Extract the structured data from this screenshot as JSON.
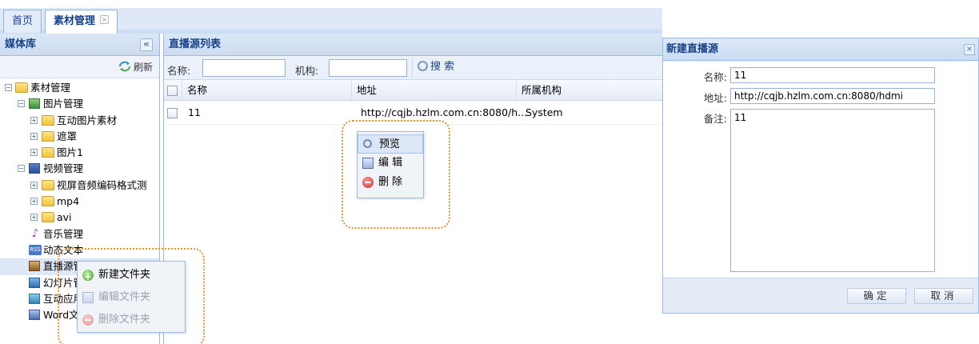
{
  "tabs": [
    {
      "label": "首页",
      "active": false
    },
    {
      "label": "素材管理",
      "active": true,
      "close": "×"
    }
  ],
  "left_panel": {
    "title": "媒体库",
    "collapse_glyph": "«",
    "refresh_label": "刷新",
    "tree": [
      {
        "label": "素材管理",
        "level": 0,
        "expander": "−",
        "icon": "folder-icon"
      },
      {
        "label": "图片管理",
        "level": 1,
        "expander": "−",
        "icon": "image-icon"
      },
      {
        "label": "互动图片素材",
        "level": 2,
        "expander": "+",
        "icon": "folder-icon"
      },
      {
        "label": "遮罩",
        "level": 2,
        "expander": "+",
        "icon": "folder-icon"
      },
      {
        "label": "图片1",
        "level": 2,
        "expander": "+",
        "icon": "folder-icon"
      },
      {
        "label": "视频管理",
        "level": 1,
        "expander": "−",
        "icon": "video-icon"
      },
      {
        "label": "视屏音频编码格式测",
        "level": 2,
        "expander": "+",
        "icon": "folder-icon"
      },
      {
        "label": "mp4",
        "level": 2,
        "expander": "+",
        "icon": "folder-icon"
      },
      {
        "label": "avi",
        "level": 2,
        "expander": "+",
        "icon": "folder-icon"
      },
      {
        "label": "音乐管理",
        "level": 1,
        "expander": "",
        "icon": "music-icon"
      },
      {
        "label": "动态文本",
        "level": 1,
        "expander": "",
        "icon": "rss-icon"
      },
      {
        "label": "直播源管理",
        "level": 1,
        "expander": "",
        "icon": "live-icon"
      },
      {
        "label": "幻灯片管理",
        "level": 1,
        "expander": "",
        "icon": "slide-icon"
      },
      {
        "label": "互动应用管理",
        "level": 1,
        "expander": "",
        "icon": "interactive-icon"
      },
      {
        "label": "Word文档管理",
        "level": 1,
        "expander": "",
        "icon": "word-icon"
      }
    ]
  },
  "main": {
    "title": "直播源列表",
    "search": {
      "name_label": "名称:",
      "org_label": "机构:",
      "button_label": "搜 索"
    },
    "columns": [
      "名称",
      "地址",
      "所属机构"
    ],
    "rows": [
      {
        "name": "11",
        "address": "http://cqjb.hzlm.com.cn:8080/h...",
        "org": "System"
      }
    ]
  },
  "row_menu": [
    {
      "label": "预览",
      "icon": "magnifier-icon",
      "highlighted": true
    },
    {
      "label": "编 辑",
      "icon": "edit-icon"
    },
    {
      "label": "删 除",
      "icon": "delete-icon"
    }
  ],
  "tree_menu": [
    {
      "label": "新建文件夹",
      "icon": "add-icon",
      "enabled": true
    },
    {
      "label": "编辑文件夹",
      "icon": "edit-icon",
      "enabled": false
    },
    {
      "label": "删除文件夹",
      "icon": "delete-icon",
      "enabled": false
    }
  ],
  "dialog": {
    "title": "新建直播源",
    "close": "×",
    "name_label": "名称:",
    "name_value": "11",
    "address_label": "地址:",
    "address_value": "http://cqjb.hzlm.com.cn:8080/hdmi",
    "note_label": "备注:",
    "note_value": "11",
    "ok_label": "确定",
    "cancel_label": "取消"
  },
  "colors": {
    "accent": "#15428b",
    "border": "#99bbe8",
    "highlight_ring": "#e8922f"
  }
}
